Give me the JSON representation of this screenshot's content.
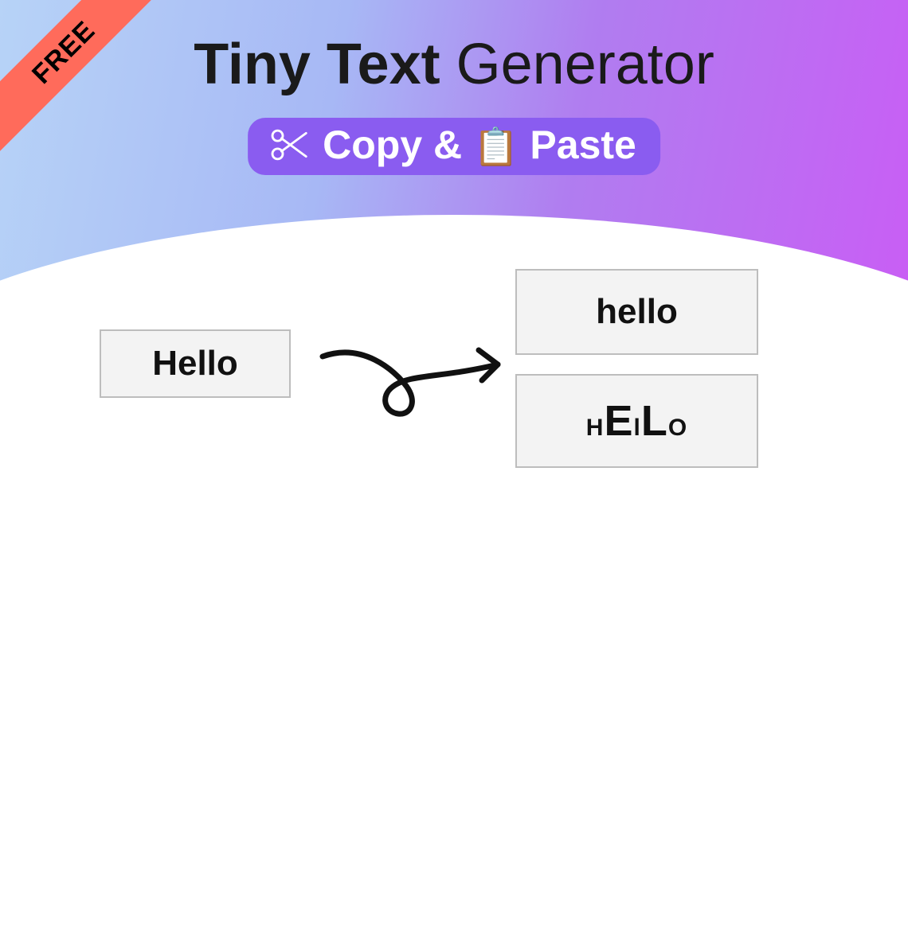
{
  "ribbon": {
    "label": "FREE"
  },
  "heading": {
    "bold": "Tiny Text",
    "rest": " Generator"
  },
  "badge": {
    "scissors_icon": "scissors-icon",
    "copy_label": "Copy &",
    "clipboard_icon": "clipboard-icon",
    "paste_label": "Paste"
  },
  "example": {
    "input": "Hello",
    "output1": "hello",
    "output2": {
      "c1": "H",
      "c2": "E",
      "c3": "l",
      "c4": "L",
      "c5": "O"
    }
  }
}
